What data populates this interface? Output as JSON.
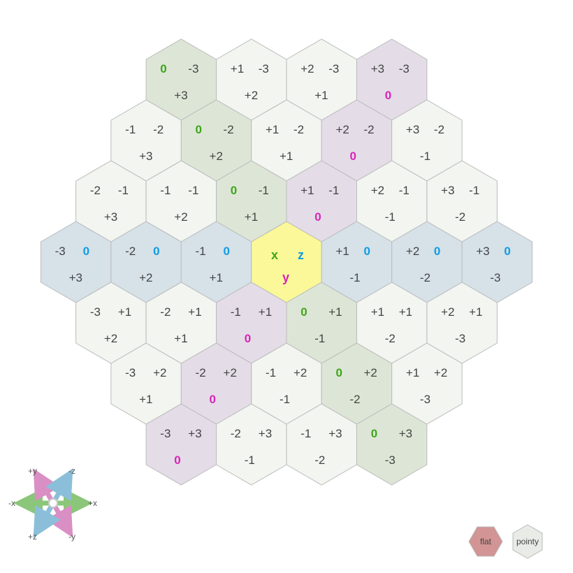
{
  "chart_data": {
    "type": "hexgrid",
    "orientation": "pointy",
    "radius": 3,
    "center_label": {
      "x": "x",
      "y": "y",
      "z": "z"
    },
    "fills": {
      "origin": "#faf898",
      "x_axis": "#dde6d6",
      "z_axis": "#d6e1e8",
      "y_axis": "#e4dce7",
      "default": "#f3f5f1",
      "legend_flat": "#d29494",
      "legend_pointy": "#e8ebe6"
    },
    "hexes": [
      {
        "x": 0,
        "y": 3,
        "z": -3,
        "fill": "x_axis"
      },
      {
        "x": -1,
        "y": 3,
        "z": -2,
        "fill": "default"
      },
      {
        "x": 1,
        "y": 2,
        "z": -3,
        "fill": "default"
      },
      {
        "x": -2,
        "y": 3,
        "z": -1,
        "fill": "default"
      },
      {
        "x": 0,
        "y": 2,
        "z": -2,
        "fill": "x_axis"
      },
      {
        "x": 2,
        "y": 1,
        "z": -3,
        "fill": "default"
      },
      {
        "x": -3,
        "y": 3,
        "z": 0,
        "fill": "z_axis"
      },
      {
        "x": -1,
        "y": 2,
        "z": -1,
        "fill": "default"
      },
      {
        "x": 1,
        "y": 1,
        "z": -2,
        "fill": "default"
      },
      {
        "x": 3,
        "y": 0,
        "z": -3,
        "fill": "y_axis"
      },
      {
        "x": -2,
        "y": 2,
        "z": 0,
        "fill": "z_axis"
      },
      {
        "x": 0,
        "y": 1,
        "z": -1,
        "fill": "x_axis"
      },
      {
        "x": 2,
        "y": 0,
        "z": -2,
        "fill": "y_axis"
      },
      {
        "x": -3,
        "y": 2,
        "z": 1,
        "fill": "default"
      },
      {
        "x": -1,
        "y": 1,
        "z": 0,
        "fill": "z_axis"
      },
      {
        "x": 1,
        "y": 0,
        "z": -1,
        "fill": "y_axis"
      },
      {
        "x": 3,
        "y": -1,
        "z": -2,
        "fill": "default"
      },
      {
        "x": -2,
        "y": 1,
        "z": 1,
        "fill": "default"
      },
      {
        "x": 0,
        "y": 0,
        "z": 0,
        "fill": "origin"
      },
      {
        "x": 2,
        "y": -1,
        "z": -1,
        "fill": "default"
      },
      {
        "x": -3,
        "y": 1,
        "z": 2,
        "fill": "default"
      },
      {
        "x": -1,
        "y": 0,
        "z": 1,
        "fill": "y_axis"
      },
      {
        "x": 1,
        "y": -1,
        "z": 0,
        "fill": "z_axis"
      },
      {
        "x": 3,
        "y": -2,
        "z": -1,
        "fill": "default"
      },
      {
        "x": -2,
        "y": 0,
        "z": 2,
        "fill": "y_axis"
      },
      {
        "x": 0,
        "y": -1,
        "z": 1,
        "fill": "x_axis"
      },
      {
        "x": 2,
        "y": -2,
        "z": 0,
        "fill": "z_axis"
      },
      {
        "x": -3,
        "y": 0,
        "z": 3,
        "fill": "y_axis"
      },
      {
        "x": -1,
        "y": -1,
        "z": 2,
        "fill": "default"
      },
      {
        "x": 1,
        "y": -2,
        "z": 1,
        "fill": "default"
      },
      {
        "x": 3,
        "y": -3,
        "z": 0,
        "fill": "z_axis"
      },
      {
        "x": -2,
        "y": -1,
        "z": 3,
        "fill": "default"
      },
      {
        "x": 0,
        "y": -2,
        "z": 2,
        "fill": "x_axis"
      },
      {
        "x": 2,
        "y": -3,
        "z": 1,
        "fill": "default"
      },
      {
        "x": -1,
        "y": -2,
        "z": 3,
        "fill": "default"
      },
      {
        "x": 1,
        "y": -3,
        "z": 2,
        "fill": "default"
      },
      {
        "x": 0,
        "y": -3,
        "z": 3,
        "fill": "x_axis"
      }
    ]
  },
  "compass": {
    "labels": {
      "plus_x": "+x",
      "minus_x": "-x",
      "plus_y": "+y",
      "minus_y": "-y",
      "plus_z": "+z",
      "minus_z": "-z"
    }
  },
  "legend": {
    "flat": "flat",
    "pointy": "pointy"
  }
}
